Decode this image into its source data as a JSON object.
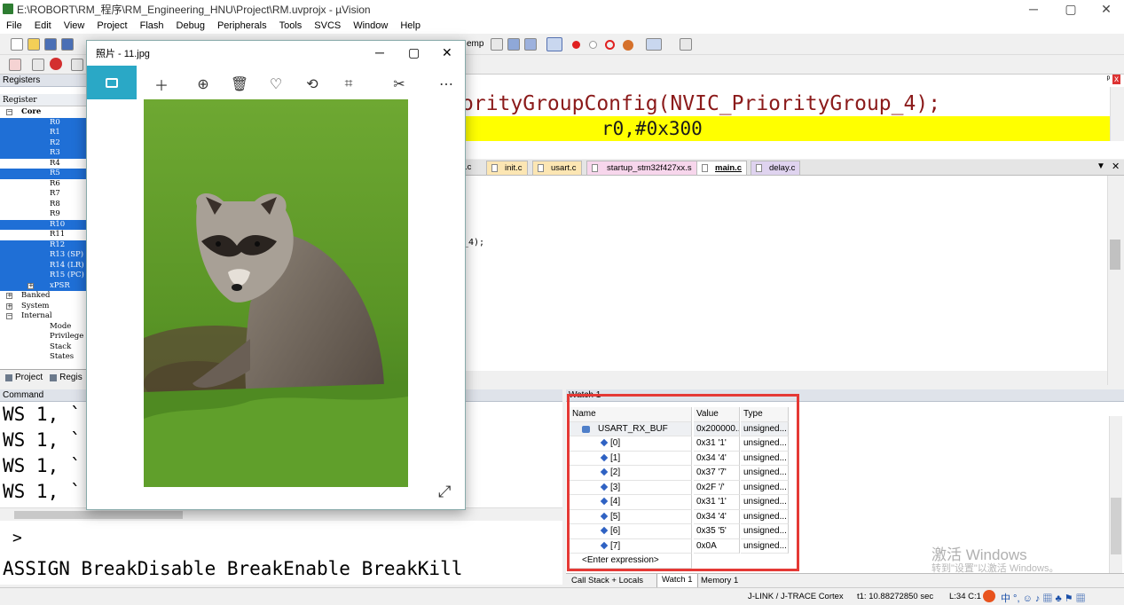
{
  "window": {
    "title": "E:\\ROBORT\\RM_程序\\RM_Engineering_HNU\\Project\\RM.uvprojx - µVision",
    "minimize_icon": "─",
    "maximize_icon": "▢",
    "close_icon": "✕"
  },
  "menu": [
    "File",
    "Edit",
    "View",
    "Project",
    "Flash",
    "Debug",
    "Peripherals",
    "Tools",
    "SVCS",
    "Window",
    "Help"
  ],
  "toolbar": {
    "partial_label": "emp"
  },
  "registers": {
    "header": "Registers",
    "column": "Register",
    "items": [
      {
        "label": "Core",
        "indent": 1,
        "selected": false,
        "bold": true,
        "exp": "−"
      },
      {
        "label": "R0",
        "indent": 3,
        "selected": true
      },
      {
        "label": "R1",
        "indent": 3,
        "selected": true
      },
      {
        "label": "R2",
        "indent": 3,
        "selected": true
      },
      {
        "label": "R3",
        "indent": 3,
        "selected": true
      },
      {
        "label": "R4",
        "indent": 3,
        "selected": false
      },
      {
        "label": "R5",
        "indent": 3,
        "selected": true
      },
      {
        "label": "R6",
        "indent": 3,
        "selected": false
      },
      {
        "label": "R7",
        "indent": 3,
        "selected": false
      },
      {
        "label": "R8",
        "indent": 3,
        "selected": false
      },
      {
        "label": "R9",
        "indent": 3,
        "selected": false
      },
      {
        "label": "R10",
        "indent": 3,
        "selected": true
      },
      {
        "label": "R11",
        "indent": 3,
        "selected": false
      },
      {
        "label": "R12",
        "indent": 3,
        "selected": true
      },
      {
        "label": "R13 (SP)",
        "indent": 3,
        "selected": true
      },
      {
        "label": "R14 (LR)",
        "indent": 3,
        "selected": true
      },
      {
        "label": "R15 (PC)",
        "indent": 3,
        "selected": true
      },
      {
        "label": "xPSR",
        "indent": 3,
        "selected": true,
        "exp": "+"
      },
      {
        "label": "Banked",
        "indent": 1,
        "selected": false,
        "exp": "+"
      },
      {
        "label": "System",
        "indent": 1,
        "selected": false,
        "exp": "+"
      },
      {
        "label": "Internal",
        "indent": 1,
        "selected": false,
        "exp": "−"
      },
      {
        "label": "Mode",
        "indent": 3,
        "selected": false
      },
      {
        "label": "Privilege",
        "indent": 3,
        "selected": false
      },
      {
        "label": "Stack",
        "indent": 3,
        "selected": false
      },
      {
        "label": "States",
        "indent": 3,
        "selected": false
      }
    ],
    "tabs": {
      "project": "Project",
      "regs": "Regis"
    }
  },
  "editor": {
    "line1": "orityGroupConfig(NVIC_PriorityGroup_4);",
    "line2": "r0,#0x300",
    "tabs": [
      {
        "label": "init.c",
        "active": false
      },
      {
        "label": "usart.c",
        "active": false
      },
      {
        "label": "startup_stm32f427xx.s",
        "active": false
      },
      {
        "label": "main.c",
        "active": true
      },
      {
        "label": "delay.c",
        "active": false
      }
    ],
    "tab_first_partial": ".c",
    "code_fragment": "_4);",
    "close_all": "✕",
    "tab_menu": "▼"
  },
  "command": {
    "header": "Command",
    "lines": [
      "WS 1, `",
      "WS 1, `",
      "WS 1, `",
      "WS 1, `"
    ],
    "prompt": ">",
    "hint": "ASSIGN BreakDisable BreakEnable BreakKill"
  },
  "watch": {
    "header": "Watch 1",
    "columns": {
      "name": "Name",
      "value": "Value",
      "type": "Type"
    },
    "root": {
      "name": "USART_RX_BUF",
      "value": "0x200000...",
      "type": "unsigned..."
    },
    "rows": [
      {
        "name": "[0]",
        "value": "0x31 '1'",
        "type": "unsigned..."
      },
      {
        "name": "[1]",
        "value": "0x34 '4'",
        "type": "unsigned..."
      },
      {
        "name": "[2]",
        "value": "0x37 '7'",
        "type": "unsigned..."
      },
      {
        "name": "[3]",
        "value": "0x2F '/'",
        "type": "unsigned..."
      },
      {
        "name": "[4]",
        "value": "0x31 '1'",
        "type": "unsigned..."
      },
      {
        "name": "[5]",
        "value": "0x34 '4'",
        "type": "unsigned..."
      },
      {
        "name": "[6]",
        "value": "0x35 '5'",
        "type": "unsigned..."
      },
      {
        "name": "[7]",
        "value": "0x0A",
        "type": "unsigned..."
      }
    ],
    "enter_expression": "<Enter expression>",
    "tabs": {
      "callstack": "Call Stack + Locals",
      "watch": "Watch 1",
      "memory": "Memory 1"
    }
  },
  "status": {
    "debugger": "J-LINK / J-TRACE Cortex",
    "time": "t1: 10.88272850 sec",
    "pos": "L:34 C:1",
    "watermark_line1": "激活 Windows",
    "watermark_line2": "转到\"设置\"以激活 Windows。"
  },
  "photos": {
    "title": "照片 - 11.jpg",
    "toolbar": [
      "＋",
      "⊕",
      "🗑",
      "♡",
      "⟲",
      "⌗",
      "✂",
      "⋯"
    ],
    "expand_icon": "⤢"
  },
  "colors": {
    "selection": "#1f6fd6",
    "highlight_line": "#ffff00",
    "code_text": "#8b1a1a",
    "watch_border": "#e53935",
    "photos_accent": "#2aa8c6"
  }
}
